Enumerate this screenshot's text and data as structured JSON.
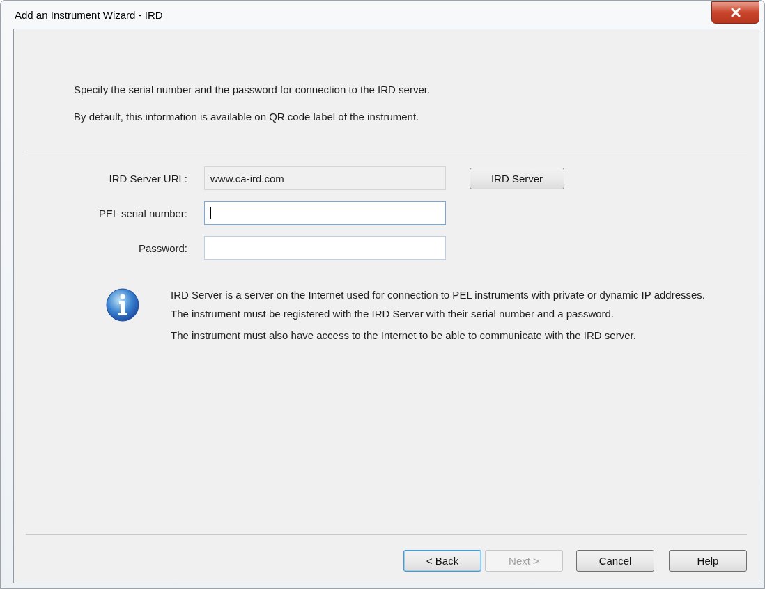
{
  "window": {
    "title": "Add an Instrument Wizard - IRD"
  },
  "intro": [
    "Specify the serial number and the password for connection to the IRD server.",
    "By default, this information is available on QR code label of the instrument."
  ],
  "fields": [
    {
      "label": "IRD Server URL:",
      "value": "www.ca-ird.com",
      "readonly": true,
      "focused": false,
      "button": "IRD Server"
    },
    {
      "label": "PEL serial number:",
      "readonly": false,
      "focused": true
    },
    {
      "label": "Password:",
      "readonly": false,
      "focused": false
    }
  ],
  "info": [
    "IRD Server is a server on the Internet used for connection to PEL instruments with private or dynamic IP addresses.",
    "The instrument must be registered with the IRD Server with their serial number and a password.",
    "The instrument must also have access to the Internet to be able to communicate with the IRD server."
  ],
  "buttons": [
    {
      "label": "< Back",
      "default": true,
      "disabled": false
    },
    {
      "label": "Next >",
      "default": false,
      "disabled": true
    },
    {
      "label": "Cancel",
      "default": false,
      "disabled": false
    },
    {
      "label": "Help",
      "default": false,
      "disabled": false
    }
  ]
}
